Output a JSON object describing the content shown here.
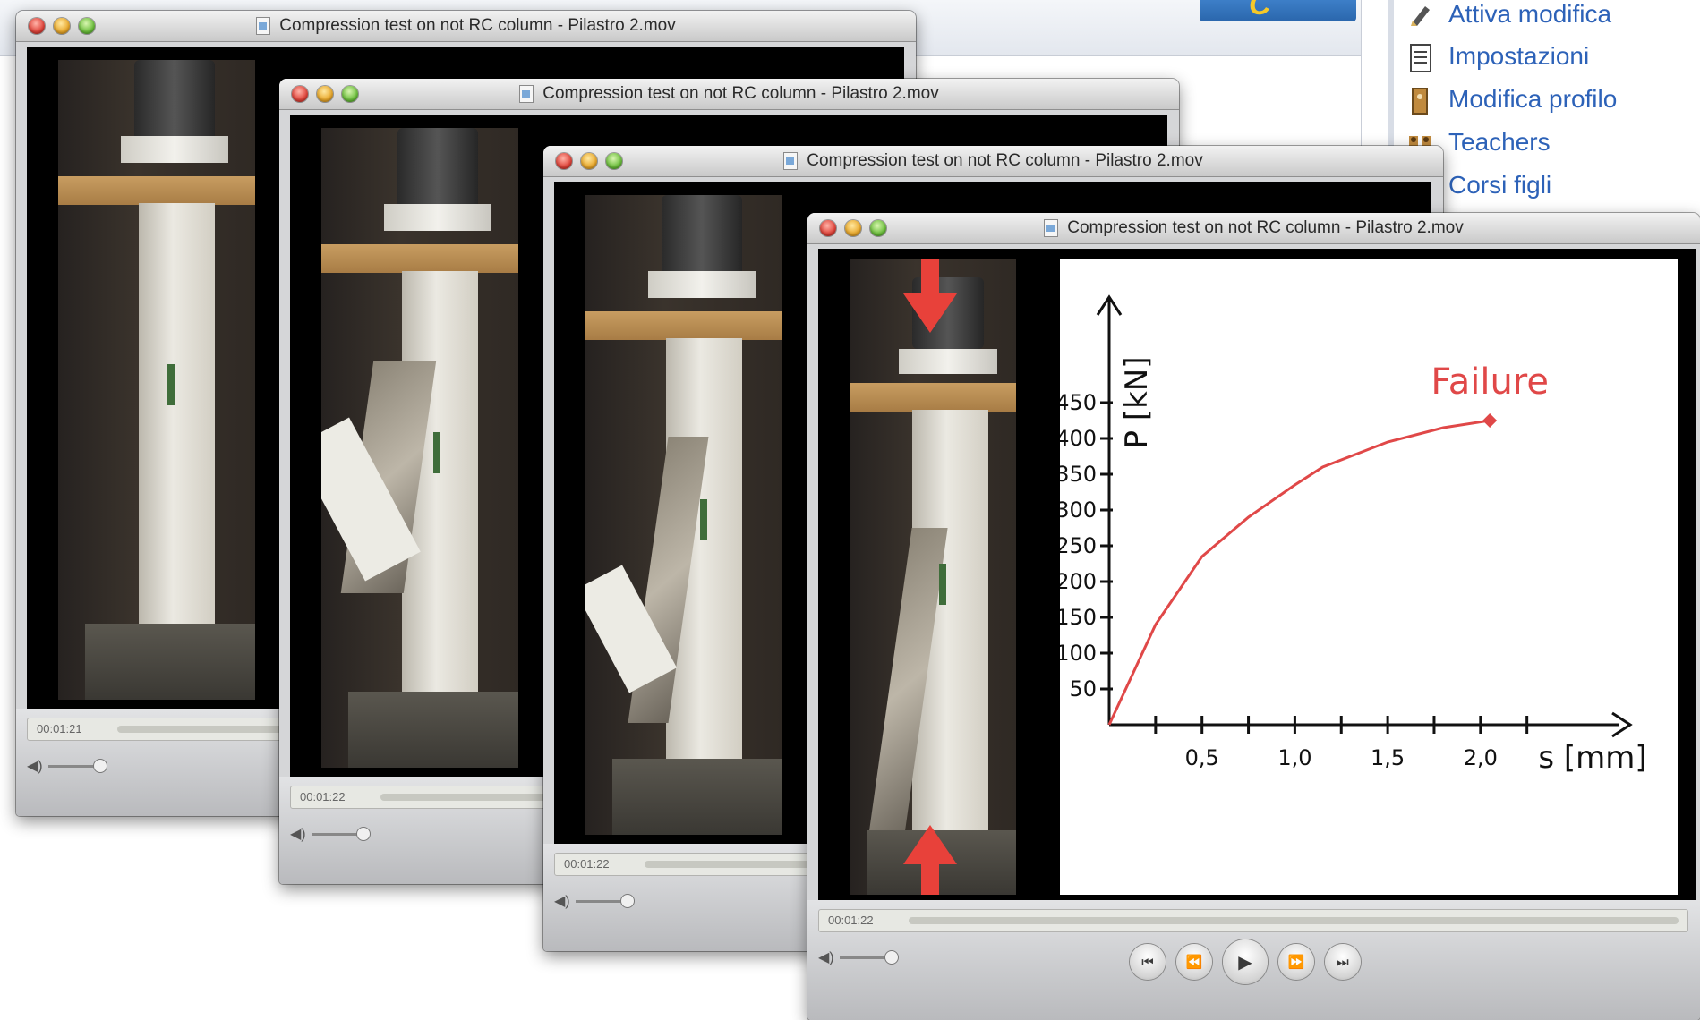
{
  "sidebar": {
    "items": [
      {
        "label": "Attiva modifica",
        "icon": "pencil-icon"
      },
      {
        "label": "Impostazioni",
        "icon": "document-icon"
      },
      {
        "label": "Modifica profilo",
        "icon": "profile-icon"
      },
      {
        "label": "Teachers",
        "icon": "people-icon"
      },
      {
        "label": "Corsi figli",
        "icon": "folder-icon"
      }
    ]
  },
  "windows": [
    {
      "title": "Compression test on not RC column - Pilastro 2.mov",
      "time": "00:01:21"
    },
    {
      "title": "Compression test on not RC column - Pilastro 2.mov",
      "time": "00:01:22"
    },
    {
      "title": "Compression test on not RC column - Pilastro 2.mov",
      "time": "00:01:22"
    },
    {
      "title": "Compression test on not RC column - Pilastro 2.mov",
      "time": "00:01:22"
    }
  ],
  "chart_data": {
    "type": "line",
    "ylabel": "P [kN]",
    "xlabel": "s [mm]",
    "annotation": "Failure",
    "xlim": [
      0,
      2.7
    ],
    "ylim": [
      0,
      500
    ],
    "x_ticks": [
      "0,5",
      "1,0",
      "1,5",
      "2,0"
    ],
    "x_tick_values": [
      0.5,
      1.0,
      1.5,
      2.0
    ],
    "y_ticks": [
      "50",
      "100",
      "150",
      "200",
      "250",
      "300",
      "350",
      "400",
      "450"
    ],
    "y_tick_values": [
      50,
      100,
      150,
      200,
      250,
      300,
      350,
      400,
      450
    ],
    "series": [
      {
        "color": "#e04848",
        "x": [
          0.0,
          0.25,
          0.5,
          0.75,
          1.0,
          1.15,
          1.5,
          1.8,
          2.05
        ],
        "y": [
          0,
          140,
          235,
          290,
          335,
          360,
          395,
          415,
          425
        ]
      }
    ],
    "colors": {
      "curve": "#e04848",
      "arrows": "#e8413a"
    }
  }
}
